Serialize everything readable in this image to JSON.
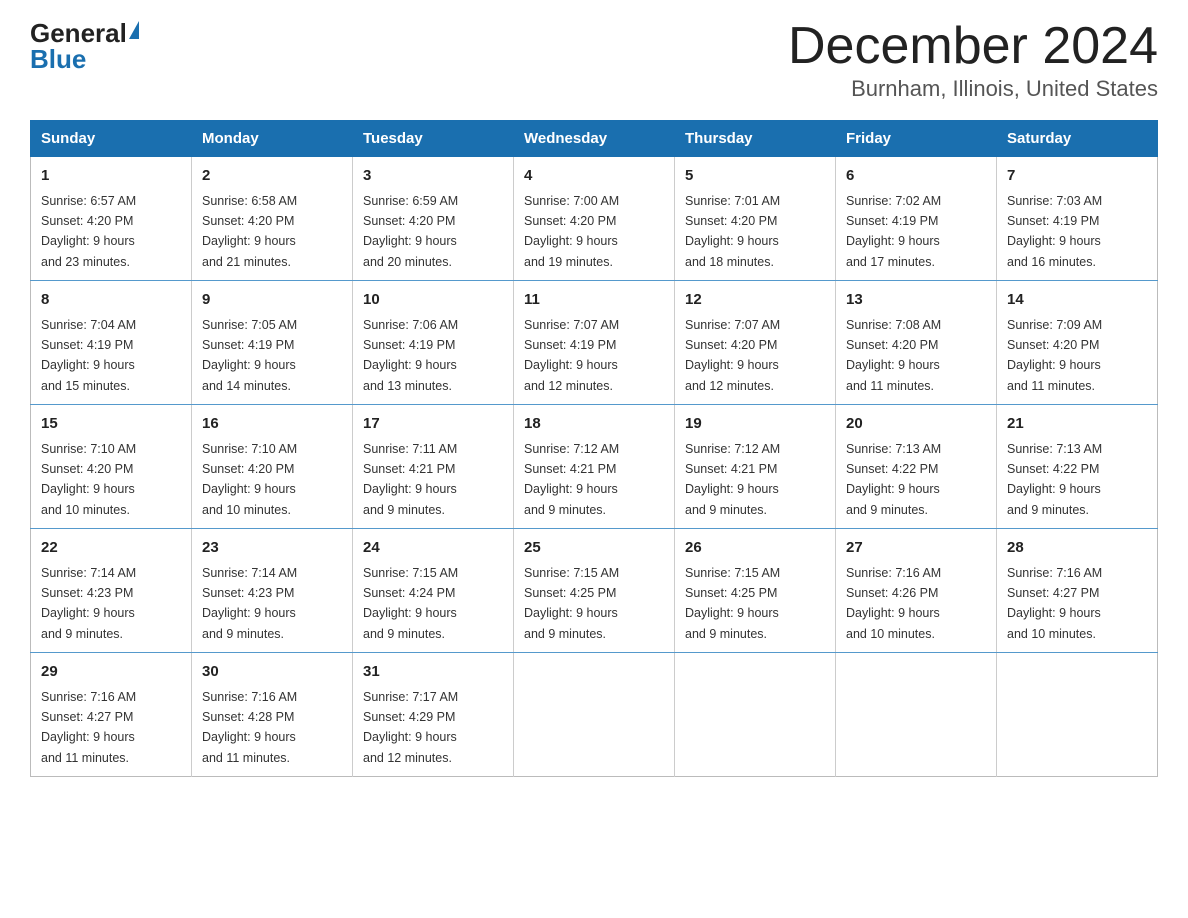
{
  "logo": {
    "general": "General",
    "blue": "Blue"
  },
  "title": {
    "month_year": "December 2024",
    "location": "Burnham, Illinois, United States"
  },
  "weekdays": [
    "Sunday",
    "Monday",
    "Tuesday",
    "Wednesday",
    "Thursday",
    "Friday",
    "Saturday"
  ],
  "weeks": [
    [
      {
        "day": "1",
        "sunrise": "6:57 AM",
        "sunset": "4:20 PM",
        "daylight": "9 hours and 23 minutes."
      },
      {
        "day": "2",
        "sunrise": "6:58 AM",
        "sunset": "4:20 PM",
        "daylight": "9 hours and 21 minutes."
      },
      {
        "day": "3",
        "sunrise": "6:59 AM",
        "sunset": "4:20 PM",
        "daylight": "9 hours and 20 minutes."
      },
      {
        "day": "4",
        "sunrise": "7:00 AM",
        "sunset": "4:20 PM",
        "daylight": "9 hours and 19 minutes."
      },
      {
        "day": "5",
        "sunrise": "7:01 AM",
        "sunset": "4:20 PM",
        "daylight": "9 hours and 18 minutes."
      },
      {
        "day": "6",
        "sunrise": "7:02 AM",
        "sunset": "4:19 PM",
        "daylight": "9 hours and 17 minutes."
      },
      {
        "day": "7",
        "sunrise": "7:03 AM",
        "sunset": "4:19 PM",
        "daylight": "9 hours and 16 minutes."
      }
    ],
    [
      {
        "day": "8",
        "sunrise": "7:04 AM",
        "sunset": "4:19 PM",
        "daylight": "9 hours and 15 minutes."
      },
      {
        "day": "9",
        "sunrise": "7:05 AM",
        "sunset": "4:19 PM",
        "daylight": "9 hours and 14 minutes."
      },
      {
        "day": "10",
        "sunrise": "7:06 AM",
        "sunset": "4:19 PM",
        "daylight": "9 hours and 13 minutes."
      },
      {
        "day": "11",
        "sunrise": "7:07 AM",
        "sunset": "4:19 PM",
        "daylight": "9 hours and 12 minutes."
      },
      {
        "day": "12",
        "sunrise": "7:07 AM",
        "sunset": "4:20 PM",
        "daylight": "9 hours and 12 minutes."
      },
      {
        "day": "13",
        "sunrise": "7:08 AM",
        "sunset": "4:20 PM",
        "daylight": "9 hours and 11 minutes."
      },
      {
        "day": "14",
        "sunrise": "7:09 AM",
        "sunset": "4:20 PM",
        "daylight": "9 hours and 11 minutes."
      }
    ],
    [
      {
        "day": "15",
        "sunrise": "7:10 AM",
        "sunset": "4:20 PM",
        "daylight": "9 hours and 10 minutes."
      },
      {
        "day": "16",
        "sunrise": "7:10 AM",
        "sunset": "4:20 PM",
        "daylight": "9 hours and 10 minutes."
      },
      {
        "day": "17",
        "sunrise": "7:11 AM",
        "sunset": "4:21 PM",
        "daylight": "9 hours and 9 minutes."
      },
      {
        "day": "18",
        "sunrise": "7:12 AM",
        "sunset": "4:21 PM",
        "daylight": "9 hours and 9 minutes."
      },
      {
        "day": "19",
        "sunrise": "7:12 AM",
        "sunset": "4:21 PM",
        "daylight": "9 hours and 9 minutes."
      },
      {
        "day": "20",
        "sunrise": "7:13 AM",
        "sunset": "4:22 PM",
        "daylight": "9 hours and 9 minutes."
      },
      {
        "day": "21",
        "sunrise": "7:13 AM",
        "sunset": "4:22 PM",
        "daylight": "9 hours and 9 minutes."
      }
    ],
    [
      {
        "day": "22",
        "sunrise": "7:14 AM",
        "sunset": "4:23 PM",
        "daylight": "9 hours and 9 minutes."
      },
      {
        "day": "23",
        "sunrise": "7:14 AM",
        "sunset": "4:23 PM",
        "daylight": "9 hours and 9 minutes."
      },
      {
        "day": "24",
        "sunrise": "7:15 AM",
        "sunset": "4:24 PM",
        "daylight": "9 hours and 9 minutes."
      },
      {
        "day": "25",
        "sunrise": "7:15 AM",
        "sunset": "4:25 PM",
        "daylight": "9 hours and 9 minutes."
      },
      {
        "day": "26",
        "sunrise": "7:15 AM",
        "sunset": "4:25 PM",
        "daylight": "9 hours and 9 minutes."
      },
      {
        "day": "27",
        "sunrise": "7:16 AM",
        "sunset": "4:26 PM",
        "daylight": "9 hours and 10 minutes."
      },
      {
        "day": "28",
        "sunrise": "7:16 AM",
        "sunset": "4:27 PM",
        "daylight": "9 hours and 10 minutes."
      }
    ],
    [
      {
        "day": "29",
        "sunrise": "7:16 AM",
        "sunset": "4:27 PM",
        "daylight": "9 hours and 11 minutes."
      },
      {
        "day": "30",
        "sunrise": "7:16 AM",
        "sunset": "4:28 PM",
        "daylight": "9 hours and 11 minutes."
      },
      {
        "day": "31",
        "sunrise": "7:17 AM",
        "sunset": "4:29 PM",
        "daylight": "9 hours and 12 minutes."
      },
      null,
      null,
      null,
      null
    ]
  ],
  "labels": {
    "sunrise": "Sunrise:",
    "sunset": "Sunset:",
    "daylight": "Daylight:"
  }
}
